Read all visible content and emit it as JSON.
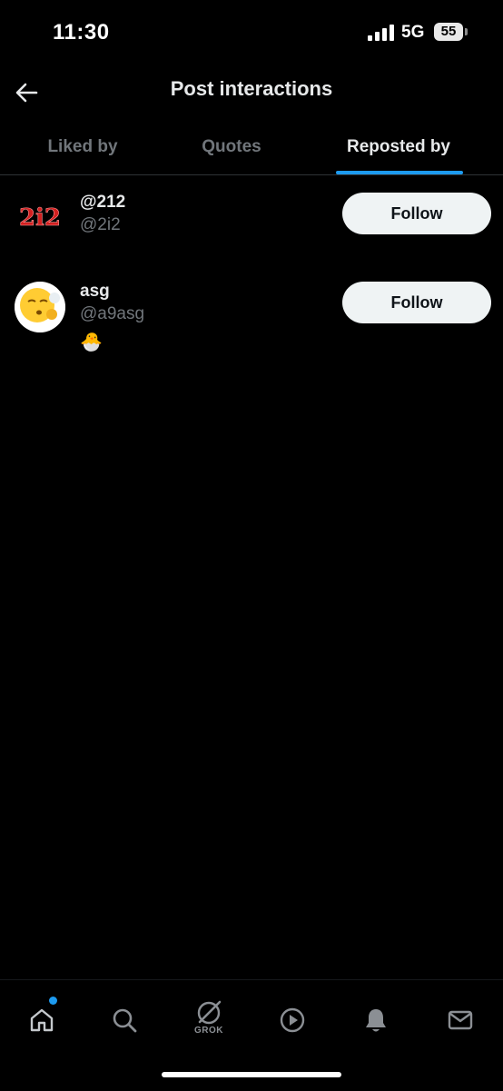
{
  "status_bar": {
    "time": "11:30",
    "network": "5G",
    "battery": "55",
    "icons": [
      "signal-icon",
      "battery-icon"
    ]
  },
  "header": {
    "title": "Post interactions",
    "back_icon": "back-arrow-icon"
  },
  "tabs": [
    {
      "label": "Liked by",
      "active": false
    },
    {
      "label": "Quotes",
      "active": false
    },
    {
      "label": "Reposted by",
      "active": true
    }
  ],
  "users": [
    {
      "name": "@212",
      "handle": "@2i2",
      "bio": "",
      "avatar_text": "2i2",
      "follow_label": "Follow"
    },
    {
      "name": "asg",
      "handle": "@a9asg",
      "bio": "🐣",
      "avatar_icon": "emoji-avatar-icon",
      "follow_label": "Follow"
    }
  ],
  "bottom_nav": {
    "items": [
      "home-icon",
      "search-icon",
      "grok-icon",
      "video-icon",
      "notifications-icon",
      "messages-icon"
    ],
    "grok_label": "GROK",
    "notification_dot": true
  },
  "colors": {
    "background": "#000000",
    "accent": "#1d9bf0",
    "text_primary": "#e7e9ea",
    "text_secondary": "#71767b",
    "button_bg": "#eff3f4"
  }
}
